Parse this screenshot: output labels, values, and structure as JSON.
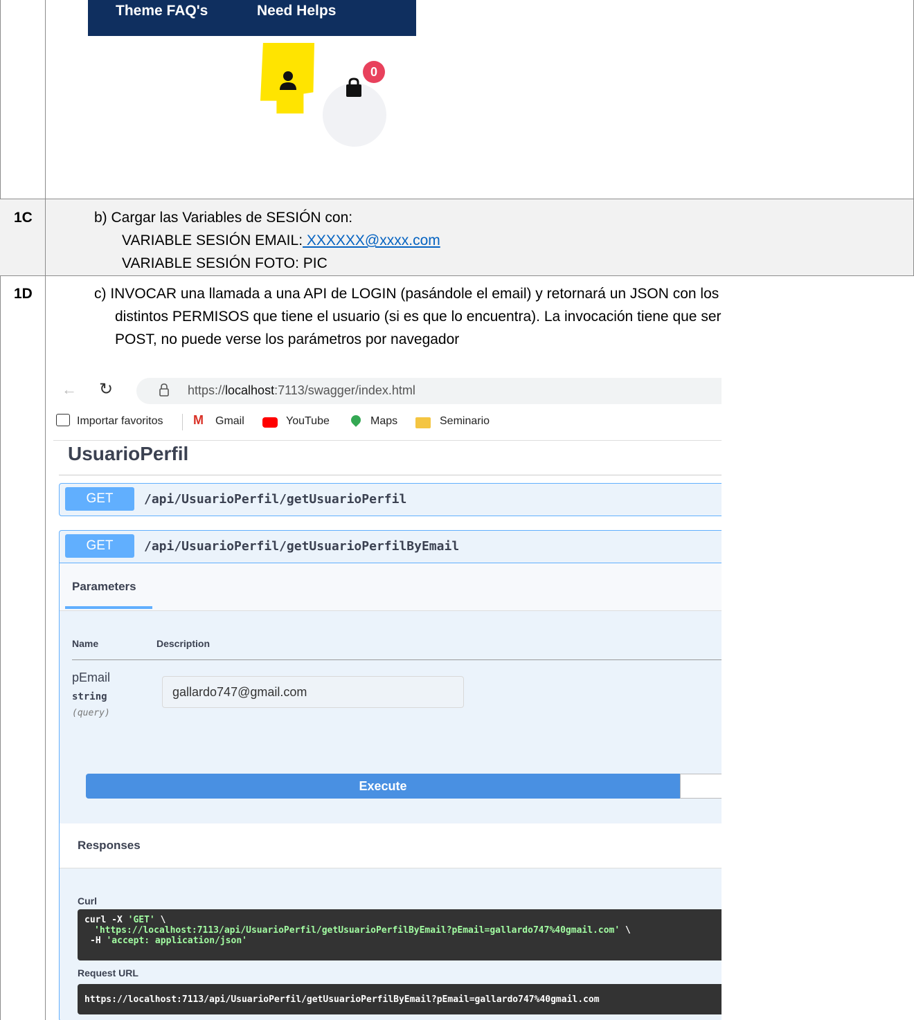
{
  "header_shot": {
    "nav": [
      "Theme FAQ's",
      "Need Helps"
    ],
    "cart_badge": "0"
  },
  "rows": [
    {
      "label": "1C",
      "lines": [
        "b) Cargar las Variables de SESIÓN con:",
        "VARIABLE SESIÓN EMAIL:",
        "VARIABLE SESIÓN FOTO: PIC"
      ],
      "email_link": " XXXXXX@xxxx.com"
    },
    {
      "label": "1D",
      "lines": [
        "c) INVOCAR una llamada a una API de LOGIN (pasándole el email) y retornará un JSON con los",
        "distintos PERMISOS que tiene el usuario (si es que lo encuentra). La invocación tiene que ser",
        "POST, no puede verse los parámetros por navegador"
      ]
    }
  ],
  "browser": {
    "url_prefix": "https://",
    "url_host": "localhost",
    "url_rest": ":7113/swagger/index.html",
    "bookmarks": [
      "Importar favoritos",
      "Gmail",
      "YouTube",
      "Maps",
      "Seminario"
    ]
  },
  "swagger": {
    "section_title": "UsuarioPerfil",
    "ops": [
      {
        "method": "GET",
        "path": "/api/UsuarioPerfil/getUsuarioPerfil"
      },
      {
        "method": "GET",
        "path": "/api/UsuarioPerfil/getUsuarioPerfilByEmail"
      }
    ],
    "params_tab": "Parameters",
    "col_name": "Name",
    "col_description": "Description",
    "param_name": "pEmail",
    "param_type": "string",
    "param_in": "(query)",
    "param_value": "gallardo747@gmail.com",
    "execute_label": "Execute",
    "responses_label": "Responses",
    "curl_label": "Curl",
    "curl_line1_a": "curl -X ",
    "curl_line1_b": "'GET'",
    "curl_line1_c": " \\",
    "curl_line2": "'https://localhost:7113/api/UsuarioPerfil/getUsuarioPerfilByEmail?pEmail=gallardo747%40gmail.com'",
    "curl_line2_tail": " \\",
    "curl_line3_a": "-H ",
    "curl_line3_b": "'accept: application/json'",
    "request_url_label": "Request URL",
    "request_url": "https://localhost:7113/api/UsuarioPerfil/getUsuarioPerfilByEmail?pEmail=gallardo747%40gmail.com"
  }
}
